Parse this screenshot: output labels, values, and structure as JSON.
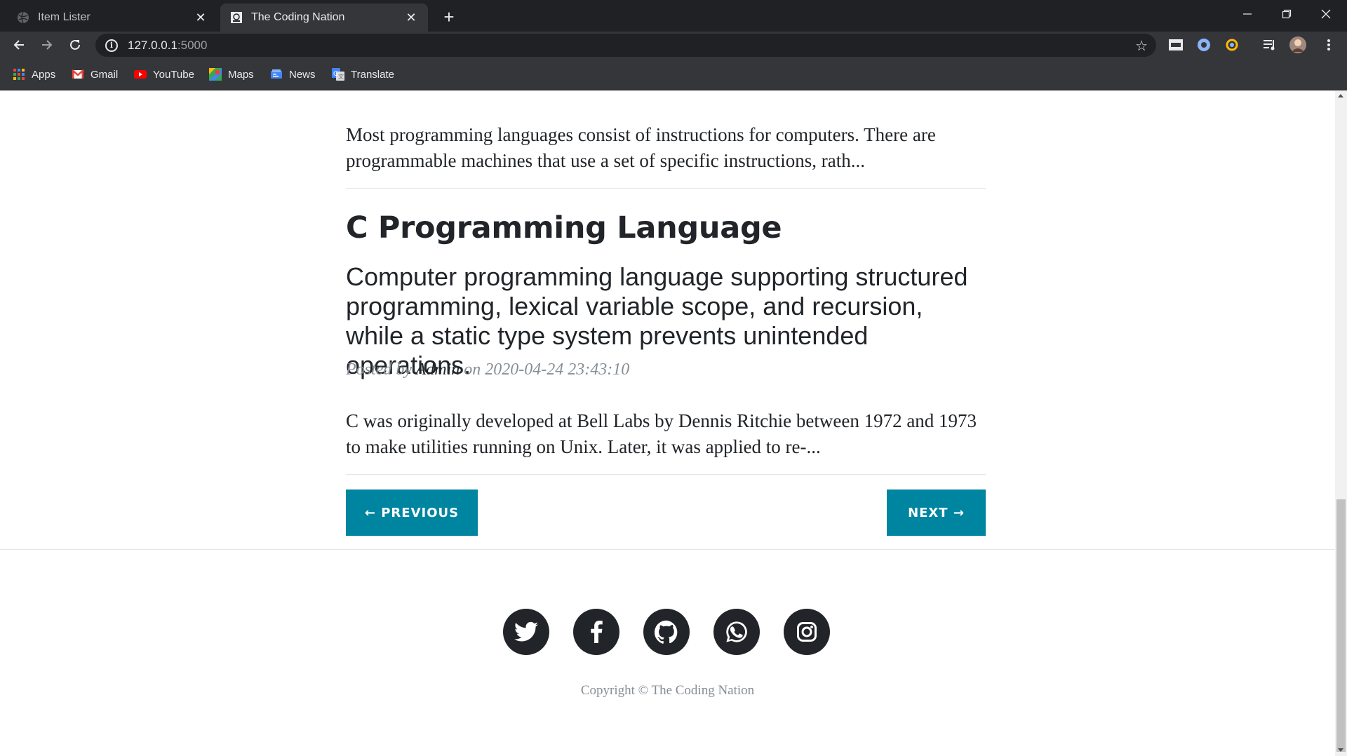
{
  "browser": {
    "tabs": [
      {
        "title": "Item Lister",
        "active": false
      },
      {
        "title": "The Coding Nation",
        "active": true
      }
    ],
    "new_tab_label": "+",
    "url_host": "127.0.0.1",
    "url_port": ":5000",
    "bookmarks": [
      {
        "label": "Apps",
        "icon": "apps-grid-icon"
      },
      {
        "label": "Gmail",
        "icon": "gmail-icon"
      },
      {
        "label": "YouTube",
        "icon": "youtube-icon"
      },
      {
        "label": "Maps",
        "icon": "maps-icon"
      },
      {
        "label": "News",
        "icon": "news-icon"
      },
      {
        "label": "Translate",
        "icon": "translate-icon"
      }
    ]
  },
  "page": {
    "previous_excerpt": "Most programming languages consist of instructions for computers. There are programmable machines that use a set of specific instructions, rath...",
    "post": {
      "title": "C Programming Language",
      "subtitle": "Computer programming language supporting structured programming, lexical variable scope, and recursion, while a static type system prevents unintended operations.",
      "meta_prefix": "Posted by",
      "author": "Admin",
      "meta_on": "on",
      "date": "2020-04-24 23:43:10",
      "excerpt": "C was originally developed at Bell Labs by Dennis Ritchie between 1972 and 1973 to make utilities running on Unix. Later, it was applied to re-..."
    },
    "pager": {
      "previous_label": "← PREVIOUS",
      "next_label": "NEXT →"
    },
    "footer": {
      "social": [
        "twitter-icon",
        "facebook-icon",
        "github-icon",
        "whatsapp-icon",
        "instagram-icon"
      ],
      "copyright": "Copyright © The Coding Nation"
    }
  },
  "colors": {
    "accent": "#0085a1",
    "text": "#212529",
    "muted": "#868e96"
  }
}
